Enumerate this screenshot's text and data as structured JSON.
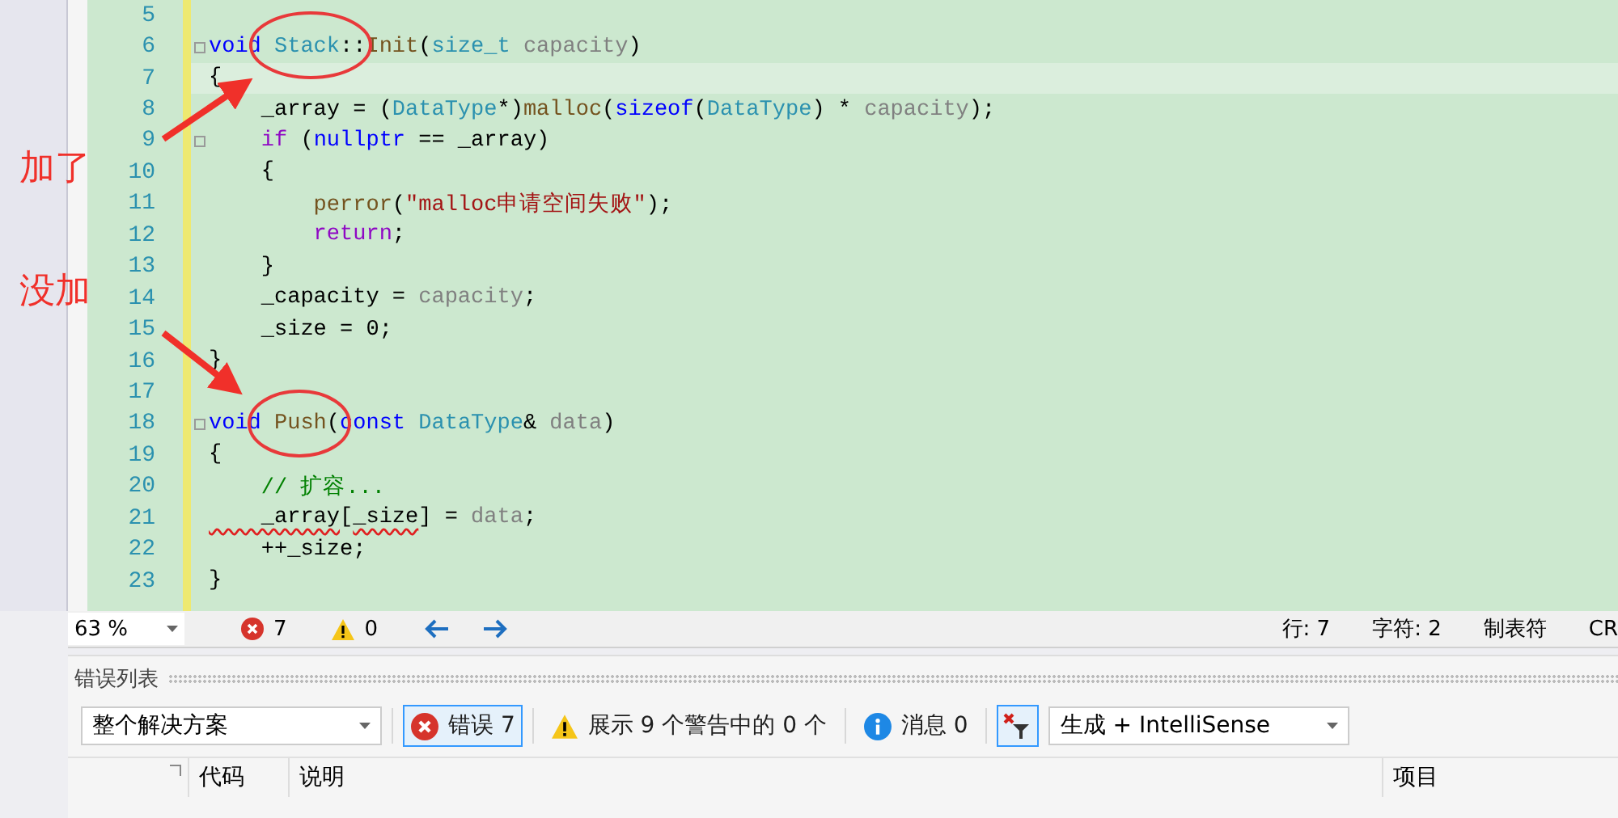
{
  "editor": {
    "lines": [
      {
        "number": "5",
        "current": false,
        "fold": false
      },
      {
        "number": "6",
        "current": false,
        "fold": true,
        "tokens": [
          {
            "text": "void",
            "kind": "keyword"
          },
          {
            "text": " Stack",
            "kind": "type"
          },
          {
            "text": "::",
            "kind": "plain"
          },
          {
            "text": "Init",
            "kind": "func"
          },
          {
            "text": "(",
            "kind": "plain"
          },
          {
            "text": "size_t",
            "kind": "type"
          },
          {
            "text": " capacity",
            "kind": "param"
          },
          {
            "text": ")",
            "kind": "plain"
          }
        ]
      },
      {
        "number": "7",
        "current": true,
        "fold": false,
        "tokens": [
          {
            "text": "{",
            "kind": "plain"
          }
        ]
      },
      {
        "number": "8",
        "current": false,
        "fold": false,
        "tokens": [
          {
            "text": "    _array = (",
            "kind": "plain"
          },
          {
            "text": "DataType",
            "kind": "type"
          },
          {
            "text": "*)",
            "kind": "plain"
          },
          {
            "text": "malloc",
            "kind": "func"
          },
          {
            "text": "(",
            "kind": "plain"
          },
          {
            "text": "sizeof",
            "kind": "keyword"
          },
          {
            "text": "(",
            "kind": "plain"
          },
          {
            "text": "DataType",
            "kind": "type"
          },
          {
            "text": ") * ",
            "kind": "plain"
          },
          {
            "text": "capacity",
            "kind": "param"
          },
          {
            "text": ");",
            "kind": "plain"
          }
        ]
      },
      {
        "number": "9",
        "current": false,
        "fold": true,
        "tokens": [
          {
            "text": "    if",
            "kind": "control"
          },
          {
            "text": " (",
            "kind": "plain"
          },
          {
            "text": "nullptr",
            "kind": "keyword"
          },
          {
            "text": " == _array)",
            "kind": "plain"
          }
        ]
      },
      {
        "number": "10",
        "current": false,
        "fold": false,
        "tokens": [
          {
            "text": "    {",
            "kind": "plain"
          }
        ]
      },
      {
        "number": "11",
        "current": false,
        "fold": false,
        "tokens": [
          {
            "text": "        perror",
            "kind": "func"
          },
          {
            "text": "(",
            "kind": "plain"
          },
          {
            "text": "\"malloc申请空间失败\"",
            "kind": "string"
          },
          {
            "text": ");",
            "kind": "plain"
          }
        ]
      },
      {
        "number": "12",
        "current": false,
        "fold": false,
        "tokens": [
          {
            "text": "        return",
            "kind": "control"
          },
          {
            "text": ";",
            "kind": "plain"
          }
        ]
      },
      {
        "number": "13",
        "current": false,
        "fold": false,
        "tokens": [
          {
            "text": "    }",
            "kind": "plain"
          }
        ]
      },
      {
        "number": "14",
        "current": false,
        "fold": false,
        "tokens": [
          {
            "text": "    _capacity = ",
            "kind": "plain"
          },
          {
            "text": "capacity",
            "kind": "param"
          },
          {
            "text": ";",
            "kind": "plain"
          }
        ]
      },
      {
        "number": "15",
        "current": false,
        "fold": false,
        "tokens": [
          {
            "text": "    _size = 0;",
            "kind": "plain"
          }
        ]
      },
      {
        "number": "16",
        "current": false,
        "fold": false,
        "tokens": [
          {
            "text": "}",
            "kind": "plain"
          }
        ]
      },
      {
        "number": "17",
        "current": false,
        "fold": false
      },
      {
        "number": "18",
        "current": false,
        "fold": true,
        "tokens": [
          {
            "text": "void",
            "kind": "keyword"
          },
          {
            "text": " Push",
            "kind": "func"
          },
          {
            "text": "(",
            "kind": "plain"
          },
          {
            "text": "const",
            "kind": "keyword"
          },
          {
            "text": " DataType",
            "kind": "type"
          },
          {
            "text": "& ",
            "kind": "plain"
          },
          {
            "text": "data",
            "kind": "param"
          },
          {
            "text": ")",
            "kind": "plain"
          }
        ]
      },
      {
        "number": "19",
        "current": false,
        "fold": false,
        "tokens": [
          {
            "text": "{",
            "kind": "plain"
          }
        ]
      },
      {
        "number": "20",
        "current": false,
        "fold": false,
        "tokens": [
          {
            "text": "    // 扩容...",
            "kind": "comment"
          }
        ]
      },
      {
        "number": "21",
        "current": false,
        "fold": false,
        "tokens": [
          {
            "text": "    _array",
            "kind": "error"
          },
          {
            "text": "[",
            "kind": "plain"
          },
          {
            "text": "_size",
            "kind": "error"
          },
          {
            "text": "] = ",
            "kind": "plain"
          },
          {
            "text": "data",
            "kind": "param"
          },
          {
            "text": ";",
            "kind": "plain"
          }
        ]
      },
      {
        "number": "22",
        "current": false,
        "fold": false,
        "tokens": [
          {
            "text": "    ++_size;",
            "kind": "plain"
          }
        ]
      },
      {
        "number": "23",
        "current": false,
        "fold": false,
        "tokens": [
          {
            "text": "}",
            "kind": "plain"
          }
        ]
      }
    ]
  },
  "annotations": [
    {
      "label": "加了",
      "kind": "top"
    },
    {
      "label": "没加",
      "kind": "bottom"
    }
  ],
  "status_bar": {
    "zoom": "63 %",
    "errors": "7",
    "warnings": "0",
    "line": "行: 7",
    "char": "字符: 2",
    "indent": "制表符",
    "line_ending": "CR"
  },
  "error_list": {
    "title": "错误列表",
    "scope": "整个解决方案",
    "errors_button": {
      "label": "错误 7",
      "selected": true
    },
    "warnings_button": {
      "label": "展示 9 个警告中的 0 个",
      "selected": false
    },
    "messages_button": {
      "label": "消息 0",
      "selected": false
    },
    "filter_button": {
      "selected": true
    },
    "source": "生成 + IntelliSense",
    "columns": [
      "代码",
      "说明",
      "项目"
    ]
  }
}
